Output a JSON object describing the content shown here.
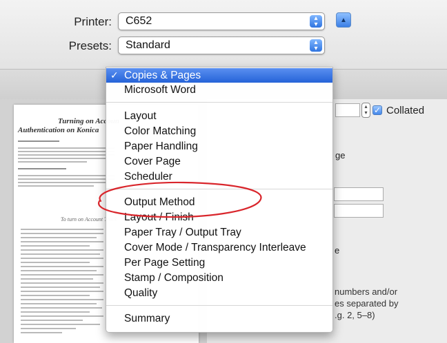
{
  "printer": {
    "label": "Printer:",
    "value": "C652"
  },
  "presets": {
    "label": "Presets:",
    "value": "Standard"
  },
  "menu": {
    "items": [
      {
        "label": "Copies & Pages",
        "selected": true
      },
      {
        "label": "Microsoft Word"
      },
      {
        "label": "Layout"
      },
      {
        "label": "Color Matching"
      },
      {
        "label": "Paper Handling"
      },
      {
        "label": "Cover Page"
      },
      {
        "label": "Scheduler"
      },
      {
        "label": "Output Method"
      },
      {
        "label": "Layout / Finish"
      },
      {
        "label": "Paper Tray / Output Tray"
      },
      {
        "label": "Cover Mode / Transparency Interleave"
      },
      {
        "label": "Per Page Setting"
      },
      {
        "label": "Stamp / Composition"
      },
      {
        "label": "Quality"
      },
      {
        "label": "Summary"
      }
    ],
    "checkmark": "✓",
    "highlighted_item": "Output Method",
    "highlight_color": "#d9262c"
  },
  "settings": {
    "collated_label": "Collated",
    "collated_checked": true,
    "range_peek": "ge",
    "other_peek": "e",
    "pages_hint_line1": "numbers and/or",
    "pages_hint_line2": "es separated by",
    "pages_hint_line3": ".g. 2, 5–8)"
  },
  "document_preview": {
    "title_line1": "Turning on Accoun",
    "title_line2": "Authentication on Konica",
    "subheading": "To turn on Account Track"
  },
  "colors": {
    "accent_blue": "#2563d8",
    "annotation_red": "#d9262c"
  }
}
